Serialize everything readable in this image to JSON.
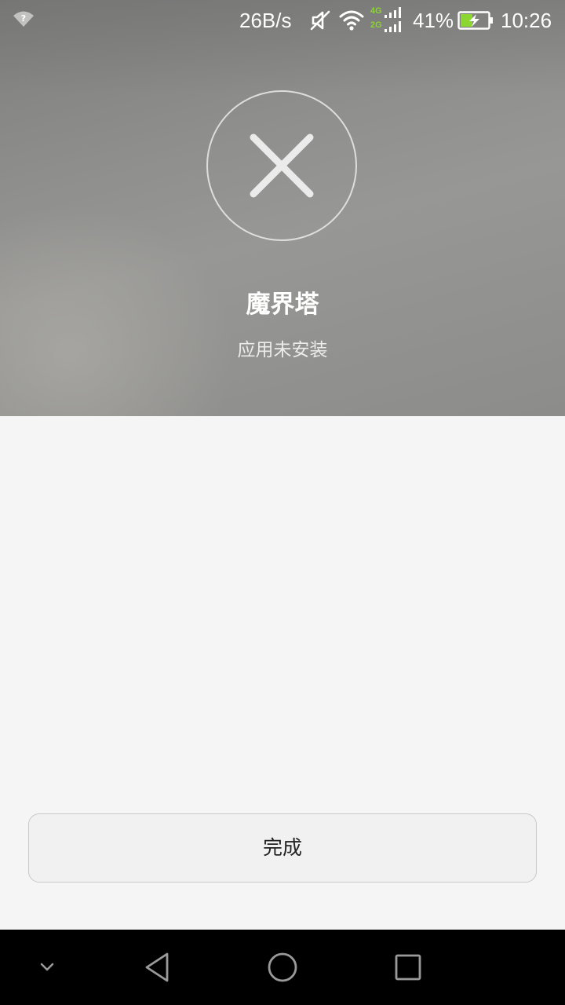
{
  "status_bar": {
    "network_speed": "26B/s",
    "network_type_top": "4G",
    "network_type_bottom": "2G",
    "battery_percent": "41%",
    "time": "10:26",
    "icons": [
      "wifi-question-icon",
      "mute-icon",
      "wifi-icon",
      "cellular-signal-icon",
      "battery-charging-icon"
    ],
    "accent_color": "#8bd630"
  },
  "result": {
    "icon": "close-icon",
    "app_name": "魔界塔",
    "message": "应用未安装"
  },
  "actions": {
    "done_label": "完成"
  },
  "navigation": {
    "icons": [
      "chevron-down-icon",
      "back-icon",
      "home-icon",
      "recents-icon"
    ]
  }
}
